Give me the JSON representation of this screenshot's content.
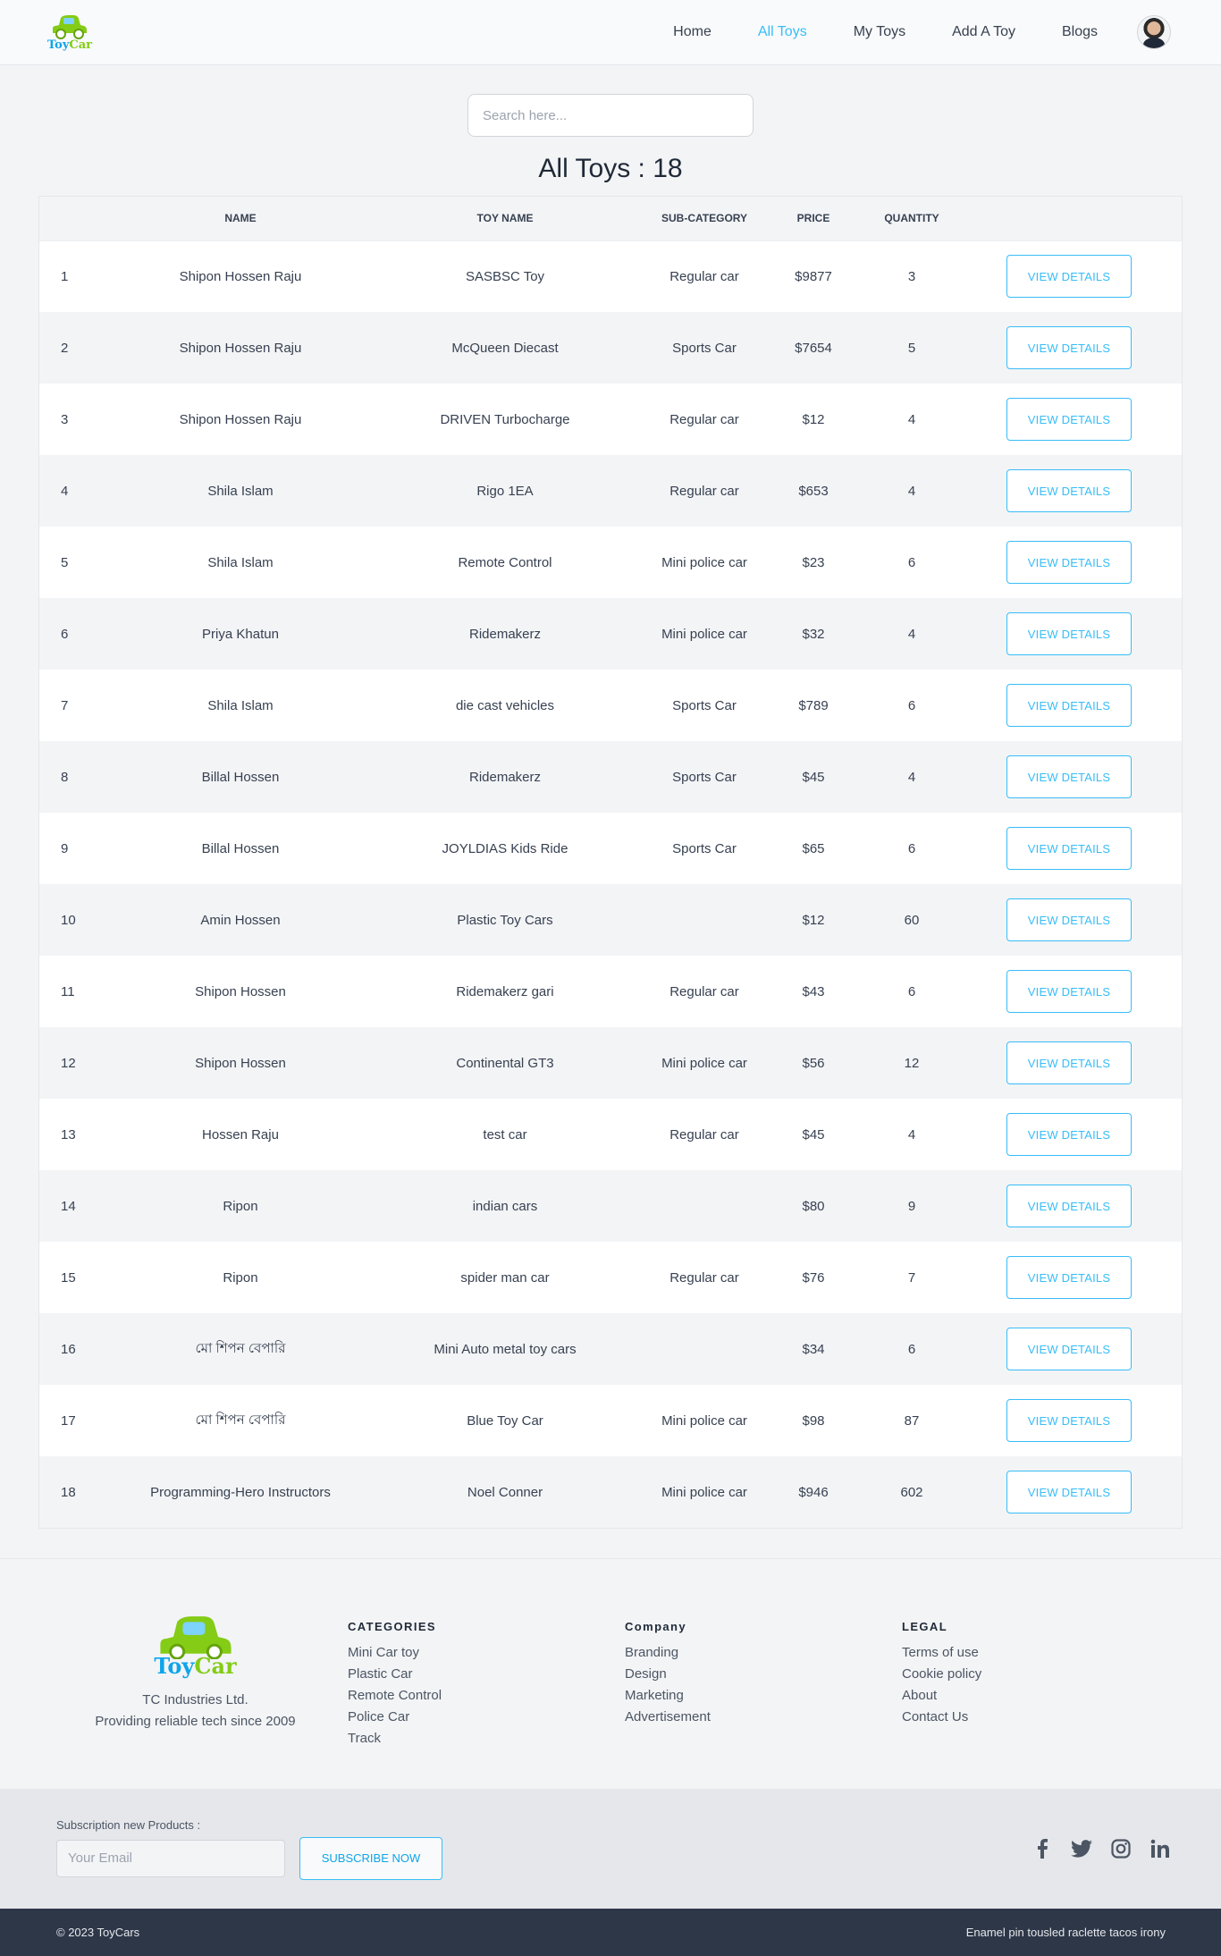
{
  "brand": {
    "logo_word_1": "Toy",
    "logo_word_2": "Car"
  },
  "nav": {
    "links": [
      "Home",
      "All Toys",
      "My Toys",
      "Add A Toy",
      "Blogs"
    ],
    "active": "All Toys"
  },
  "search": {
    "placeholder": "Search here..."
  },
  "page_title": "All Toys : 18",
  "table": {
    "headers": [
      "",
      "Name",
      "Toy Name",
      "Sub-Category",
      "Price",
      "Quantity",
      ""
    ],
    "action_label": "VIEW DETAILS",
    "rows": [
      [
        "1",
        "Shipon Hossen Raju",
        "SASBSC Toy",
        "Regular car",
        "$9877",
        "3"
      ],
      [
        "2",
        "Shipon Hossen Raju",
        "McQueen Diecast",
        "Sports Car",
        "$7654",
        "5"
      ],
      [
        "3",
        "Shipon Hossen Raju",
        "DRIVEN Turbocharge",
        "Regular car",
        "$12",
        "4"
      ],
      [
        "4",
        "Shila Islam",
        "Rigo 1EA",
        "Regular car",
        "$653",
        "4"
      ],
      [
        "5",
        "Shila Islam",
        "Remote Control",
        "Mini police car",
        "$23",
        "6"
      ],
      [
        "6",
        "Priya Khatun",
        "Ridemakerz",
        "Mini police car",
        "$32",
        "4"
      ],
      [
        "7",
        "Shila Islam",
        "die cast vehicles",
        "Sports Car",
        "$789",
        "6"
      ],
      [
        "8",
        "Billal Hossen",
        "Ridemakerz",
        "Sports Car",
        "$45",
        "4"
      ],
      [
        "9",
        "Billal Hossen",
        "JOYLDIAS Kids Ride",
        "Sports Car",
        "$65",
        "6"
      ],
      [
        "10",
        "Amin Hossen",
        "Plastic Toy Cars",
        "",
        "$12",
        "60"
      ],
      [
        "11",
        "Shipon Hossen",
        "Ridemakerz gari",
        "Regular car",
        "$43",
        "6"
      ],
      [
        "12",
        "Shipon Hossen",
        "Continental GT3",
        "Mini police car",
        "$56",
        "12"
      ],
      [
        "13",
        "Hossen Raju",
        "test car",
        "Regular car",
        "$45",
        "4"
      ],
      [
        "14",
        "Ripon",
        "indian cars",
        "",
        "$80",
        "9"
      ],
      [
        "15",
        "Ripon",
        "spider man car",
        "Regular car",
        "$76",
        "7"
      ],
      [
        "16",
        "মো শিপন বেপারি",
        "Mini Auto metal toy cars",
        "",
        "$34",
        "6"
      ],
      [
        "17",
        "মো শিপন বেপারি",
        "Blue Toy Car",
        "Mini police car",
        "$98",
        "87"
      ],
      [
        "18",
        "Programming-Hero Instructors",
        "Noel Conner",
        "Mini police car",
        "$946",
        "602"
      ]
    ]
  },
  "footer": {
    "company_name": "TC Industries Ltd.",
    "tagline": "Providing reliable tech since 2009",
    "columns": [
      {
        "title": "CATEGORIES",
        "links": [
          "Mini Car toy",
          "Plastic Car",
          "Remote Control",
          "Police Car",
          "Track"
        ]
      },
      {
        "title": "Company",
        "links": [
          "Branding",
          "Design",
          "Marketing",
          "Advertisement"
        ]
      },
      {
        "title": "LEGAL",
        "links": [
          "Terms of use",
          "Cookie policy",
          "About",
          "Contact Us"
        ]
      }
    ],
    "subscribe_label": "Subscription new Products :",
    "email_placeholder": "Your Email",
    "subscribe_button": "SUBSCRIBE NOW",
    "social_icons": [
      "facebook-icon",
      "twitter-icon",
      "instagram-icon",
      "linkedin-icon"
    ],
    "copyright": "© 2023 ToyCars",
    "right_text": "Enamel pin tousled raclette tacos irony"
  },
  "colors": {
    "accent": "#38bdf8",
    "logo_green": "#84cc16",
    "logo_blue": "#0ea5e9",
    "footer_dark": "#2d3748"
  }
}
